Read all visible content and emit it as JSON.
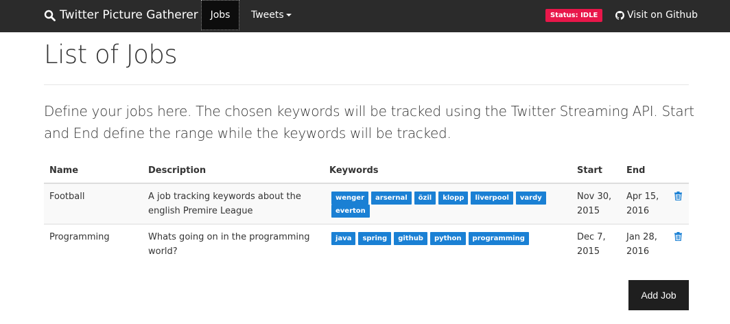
{
  "nav": {
    "brand": "Twitter Picture Gatherer",
    "jobs": "Jobs",
    "tweets": "Tweets",
    "status": "Status: IDLE",
    "github": "Visit on Github"
  },
  "page": {
    "title": "List of Jobs",
    "lead": "Define your jobs here. The chosen keywords will be tracked using the Twitter Streaming API. Start and End define the range while the keywords will be tracked."
  },
  "table": {
    "headers": {
      "name": "Name",
      "description": "Description",
      "keywords": "Keywords",
      "start": "Start",
      "end": "End"
    },
    "rows": [
      {
        "name": "Football",
        "description": "A job tracking keywords about the english Premire League",
        "keywords": [
          "wenger",
          "arsernal",
          "özil",
          "klopp",
          "liverpool",
          "vardy",
          "everton"
        ],
        "start": "Nov 30, 2015",
        "end": "Apr 15, 2016"
      },
      {
        "name": "Programming",
        "description": "Whats going on in the programming world?",
        "keywords": [
          "java",
          "spring",
          "github",
          "python",
          "programming"
        ],
        "start": "Dec 7, 2015",
        "end": "Jan 28, 2016"
      }
    ]
  },
  "actions": {
    "add_job": "Add Job"
  },
  "colors": {
    "navbar": "#2b2b2b",
    "status": "#e8174a",
    "keyword": "#1a80d4",
    "trash": "#1a80d4"
  },
  "icons": [
    "search-icon",
    "caret-down-icon",
    "github-icon",
    "trash-icon"
  ]
}
